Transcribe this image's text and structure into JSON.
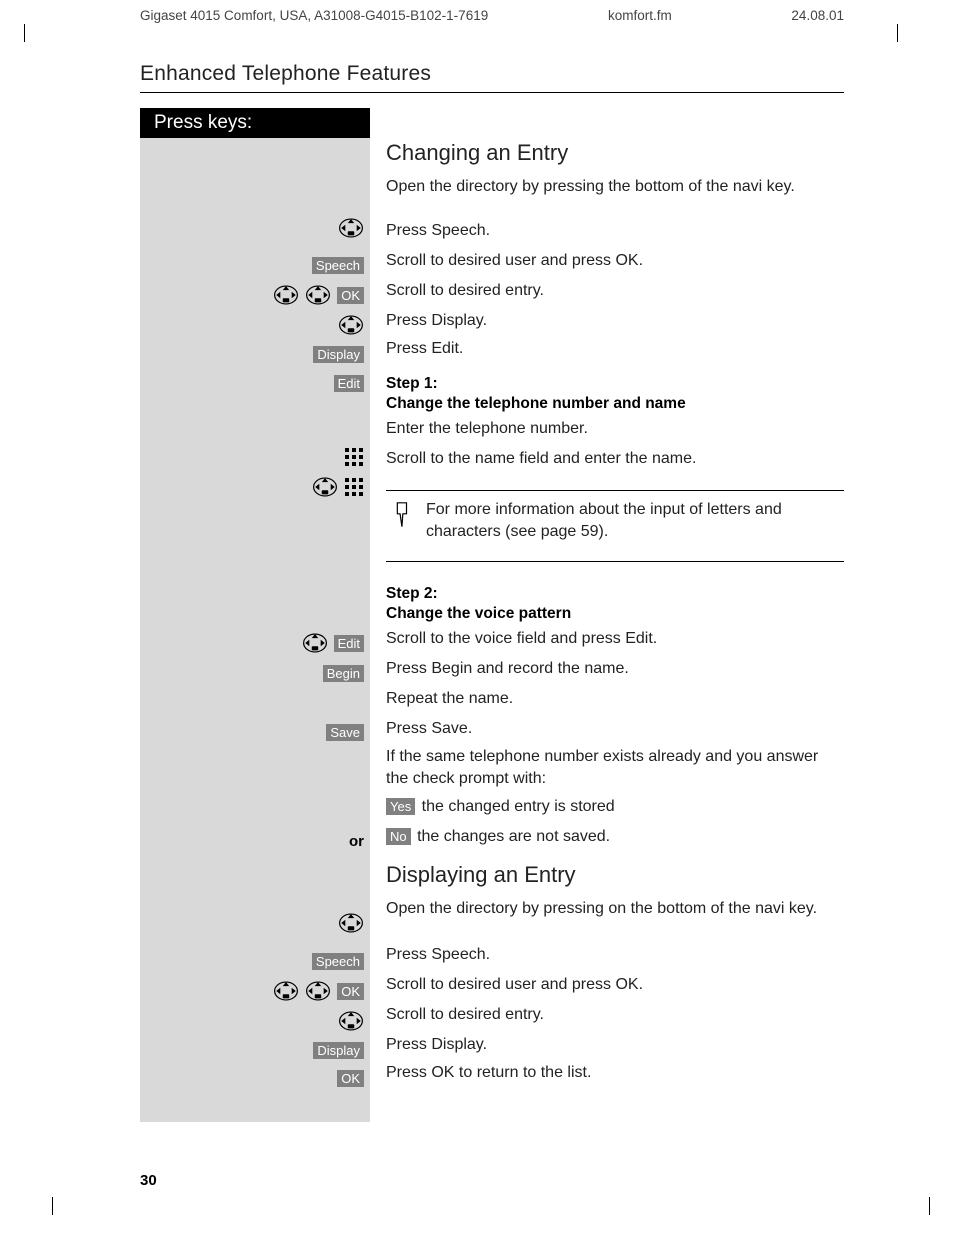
{
  "header": {
    "left": "Gigaset 4015 Comfort, USA, A31008-G4015-B102-1-7619",
    "center": "komfort.fm",
    "right": "24.08.01"
  },
  "section_title": "Enhanced Telephone Features",
  "press_keys_label": "Press keys:",
  "page_number": "30",
  "labels": {
    "speech": "Speech",
    "ok": "OK",
    "display": "Display",
    "edit": "Edit",
    "begin": "Begin",
    "save": "Save",
    "yes": "Yes",
    "no": "No"
  },
  "or_label": "or",
  "sec1": {
    "title": "Changing an Entry",
    "r1": "Open the directory by pressing the bottom of the navi key.",
    "r2": "Press Speech.",
    "r3": "Scroll to desired user and press OK.",
    "r4": "Scroll to desired entry.",
    "r5": "Press Display.",
    "r6": "Press Edit.",
    "step1a": "Step 1:",
    "step1b": "Change the telephone number and name",
    "r7": "Enter the telephone number.",
    "r8": "Scroll to the name field and enter the name.",
    "note": "For more information about the input of letters and characters (see page 59).",
    "step2a": "Step 2:",
    "step2b": "Change the voice pattern",
    "r9": "Scroll to the voice field and press Edit.",
    "r10": "Press Begin and record the name.",
    "r11": "Repeat the name.",
    "r12": "Press Save.",
    "r13": "If the same telephone number exists already and you answer the check prompt with:",
    "r14_suffix": " the changed entry is stored",
    "r15_suffix": " the changes are not saved."
  },
  "sec2": {
    "title": "Displaying an Entry",
    "r1": "Open the directory by pressing on the bottom of the navi key.",
    "r2": "Press Speech.",
    "r3": "Scroll to desired user and press OK.",
    "r4": "Scroll to desired entry.",
    "r5": "Press Display.",
    "r6": "Press OK to return to the list."
  }
}
